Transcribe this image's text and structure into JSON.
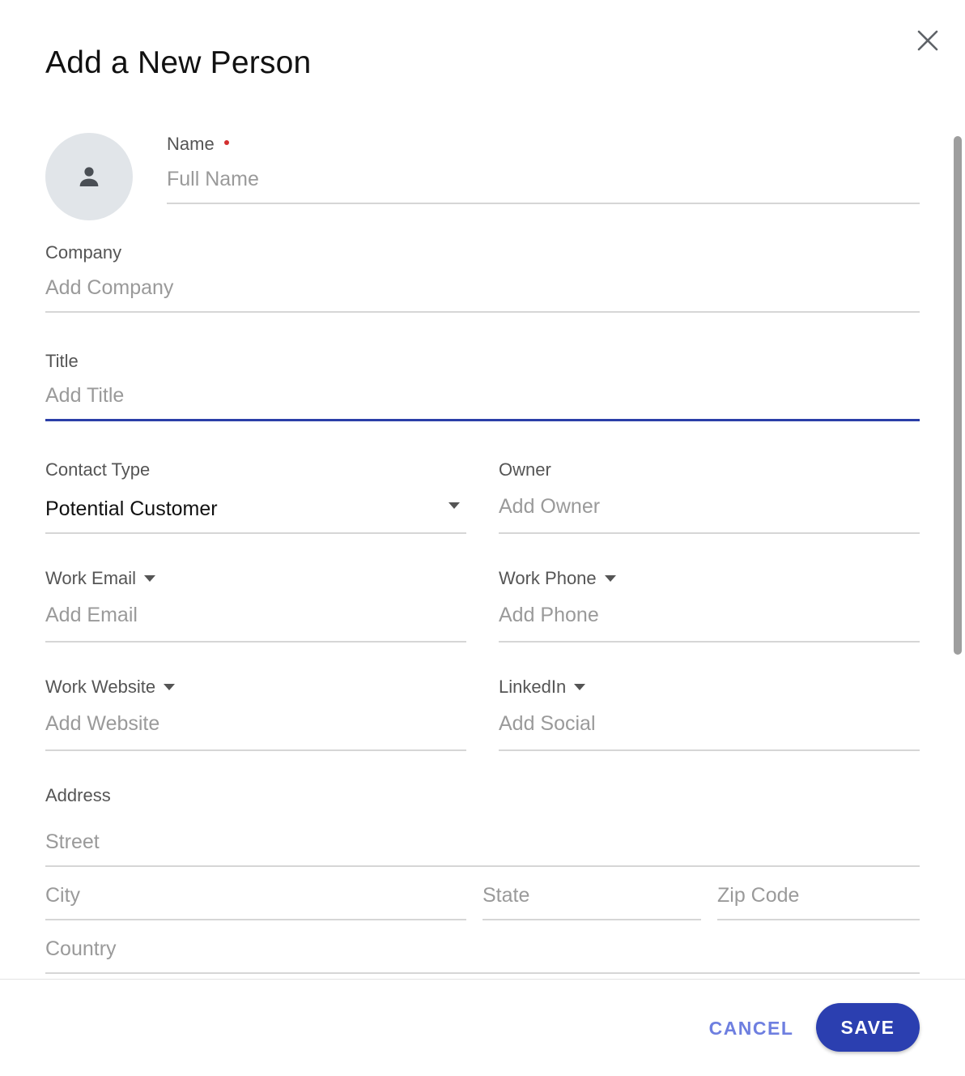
{
  "dialog": {
    "title": "Add a New Person"
  },
  "icons": {
    "close": "close-icon",
    "avatar": "person-icon",
    "caret": "caret-down-icon"
  },
  "fields": {
    "name": {
      "label": "Name",
      "placeholder": "Full Name",
      "required": true
    },
    "company": {
      "label": "Company",
      "placeholder": "Add Company"
    },
    "title": {
      "label": "Title",
      "placeholder": "Add Title"
    },
    "contact_type": {
      "label": "Contact Type",
      "value": "Potential Customer"
    },
    "owner": {
      "label": "Owner",
      "placeholder": "Add Owner"
    },
    "email": {
      "label": "Work Email",
      "placeholder": "Add Email"
    },
    "phone": {
      "label": "Work Phone",
      "placeholder": "Add Phone"
    },
    "website": {
      "label": "Work Website",
      "placeholder": "Add Website"
    },
    "social": {
      "label": "LinkedIn",
      "placeholder": "Add Social"
    },
    "address": {
      "label": "Address",
      "street": "Street",
      "city": "City",
      "state": "State",
      "zip": "Zip Code",
      "country": "Country"
    }
  },
  "actions": {
    "cancel": "CANCEL",
    "save": "SAVE"
  },
  "colors": {
    "accent": "#2b3fb0",
    "cancel_text": "#6e7fe0",
    "required_dot": "#d32f2f"
  }
}
